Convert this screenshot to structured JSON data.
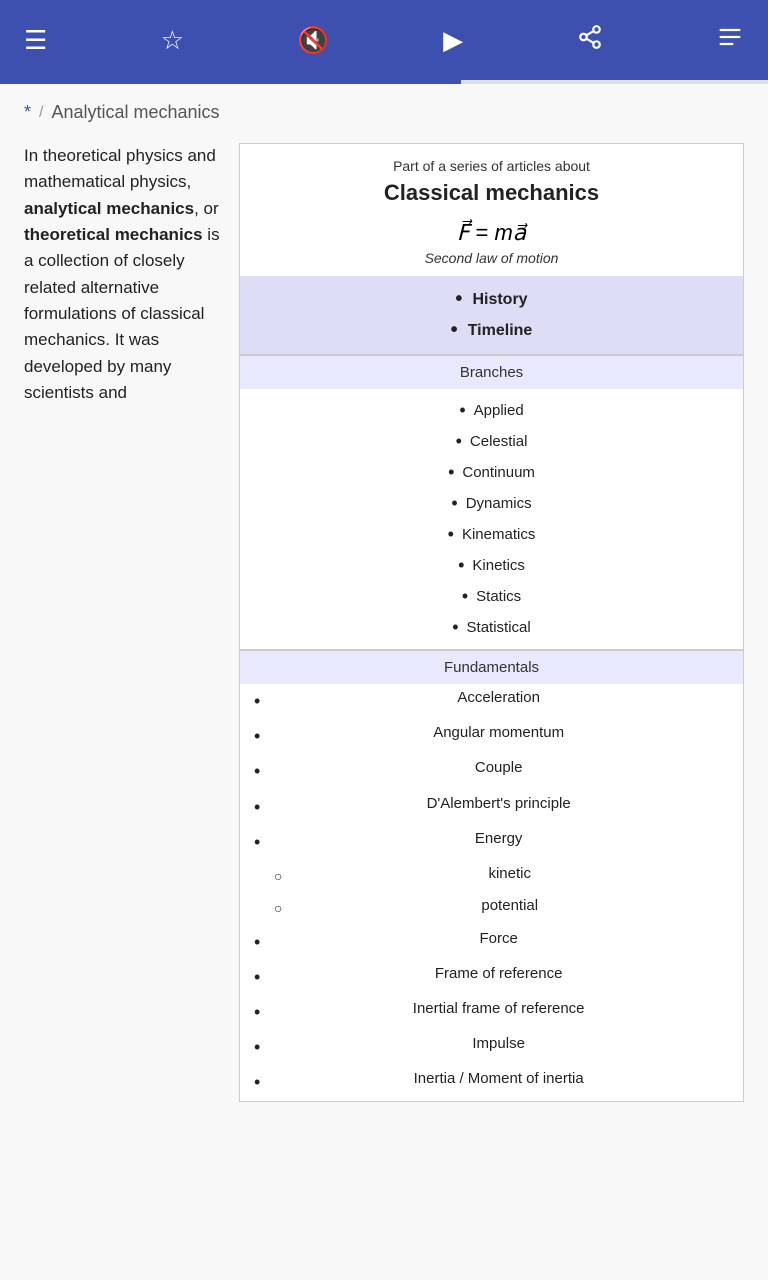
{
  "topbar": {
    "menu_icon": "☰",
    "star_icon": "☆",
    "mute_icon": "🔇",
    "play_icon": "▶",
    "share_icon": "⎘",
    "more_icon": "≡"
  },
  "breadcrumb": {
    "star": "*",
    "separator": "/",
    "title": "Analytical mechanics"
  },
  "left_text": {
    "paragraph": "In theoretical physics and mathematical physics, analytical mechanics, or theoretical mechanics is a collection of closely related alternative formulations of classical mechanics. It was developed by many scientists and"
  },
  "infobox": {
    "series_label": "Part of a series of articles about",
    "title": "Classical mechanics",
    "formula": "F⃗ = ma⃗",
    "formula_law": "Second law of motion",
    "history_items": [
      "History",
      "Timeline"
    ],
    "branches_header": "Branches",
    "branches": [
      "Applied",
      "Celestial",
      "Continuum",
      "Dynamics",
      "Kinematics",
      "Kinetics",
      "Statics",
      "Statistical"
    ],
    "fundamentals_header": "Fundamentals",
    "fundamentals": [
      {
        "type": "bullet",
        "text": "Acceleration"
      },
      {
        "type": "bullet",
        "text": "Angular momentum"
      },
      {
        "type": "bullet",
        "text": "Couple"
      },
      {
        "type": "bullet",
        "text": "D'Alembert's principle"
      },
      {
        "type": "bullet",
        "text": "Energy"
      },
      {
        "type": "circle",
        "text": "kinetic"
      },
      {
        "type": "circle",
        "text": "potential"
      },
      {
        "type": "bullet",
        "text": "Force"
      },
      {
        "type": "bullet",
        "text": "Frame of reference"
      },
      {
        "type": "bullet",
        "text": "Inertial frame of reference"
      },
      {
        "type": "bullet",
        "text": "Impulse"
      },
      {
        "type": "bullet",
        "text": "Inertia / Moment of inertia"
      }
    ]
  }
}
